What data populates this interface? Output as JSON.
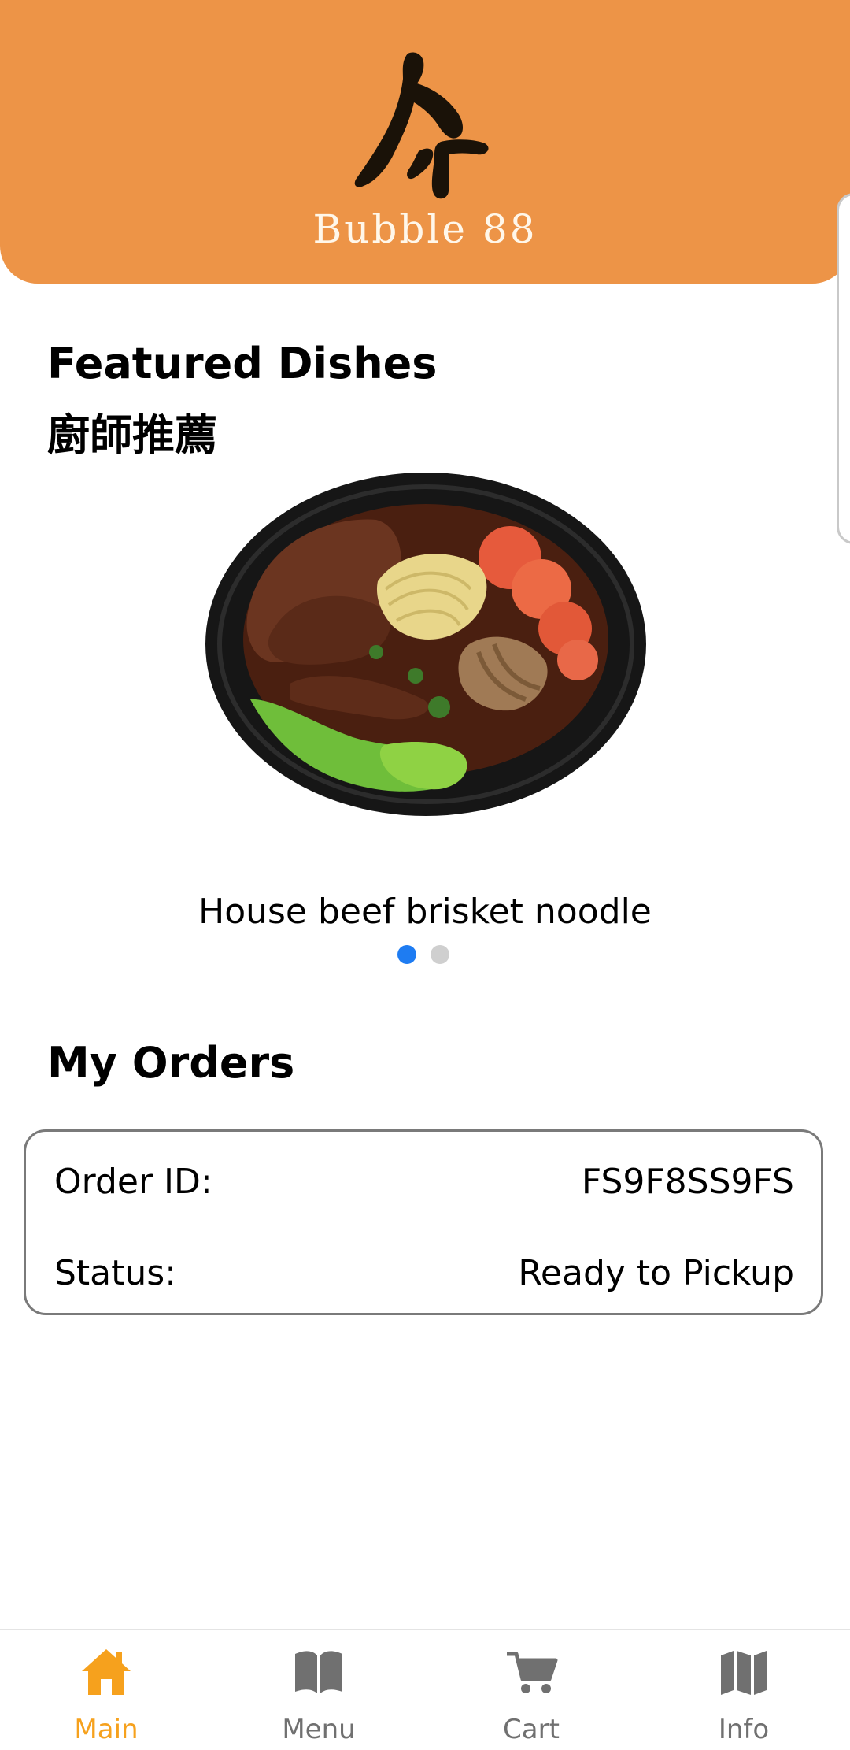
{
  "header": {
    "brand_name": "Bubble 88",
    "logo_icon": "calligraphy-logo-icon",
    "background_color": "#ED9447"
  },
  "featured": {
    "title": "Featured Dishes",
    "subtitle_zh": "廚師推薦",
    "dish_name": "House beef brisket noodle",
    "carousel_total": 2,
    "carousel_active": 1
  },
  "orders": {
    "title": "My Orders",
    "order_id_label": "Order ID:",
    "order_id_value": "FS9F8SS9FS",
    "status_label": "Status:",
    "status_value": "Ready to Pickup"
  },
  "tabbar": {
    "active_color": "#F6A11D",
    "inactive_color": "#707070",
    "items": [
      {
        "label": "Main",
        "icon": "home-icon",
        "active": true
      },
      {
        "label": "Menu",
        "icon": "book-icon",
        "active": false
      },
      {
        "label": "Cart",
        "icon": "cart-icon",
        "active": false
      },
      {
        "label": "Info",
        "icon": "map-icon",
        "active": false
      }
    ]
  }
}
